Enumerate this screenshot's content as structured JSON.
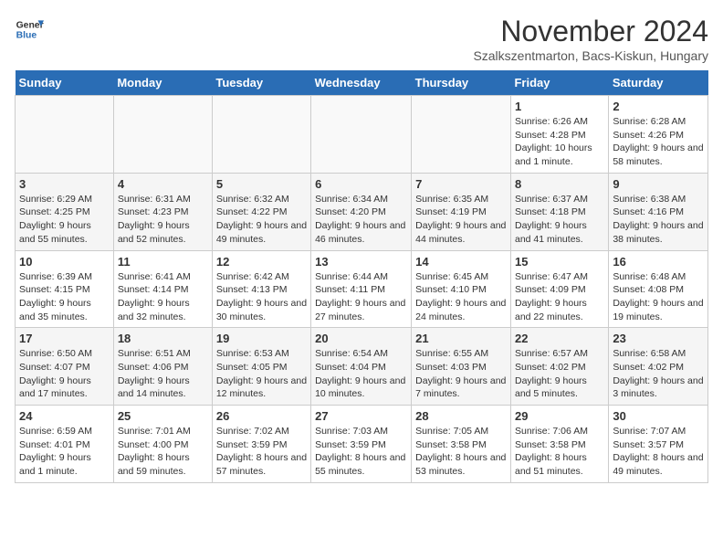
{
  "logo": {
    "line1": "General",
    "line2": "Blue"
  },
  "title": "November 2024",
  "subtitle": "Szalkszentmarton, Bacs-Kiskun, Hungary",
  "weekdays": [
    "Sunday",
    "Monday",
    "Tuesday",
    "Wednesday",
    "Thursday",
    "Friday",
    "Saturday"
  ],
  "weeks": [
    [
      {
        "day": "",
        "info": ""
      },
      {
        "day": "",
        "info": ""
      },
      {
        "day": "",
        "info": ""
      },
      {
        "day": "",
        "info": ""
      },
      {
        "day": "",
        "info": ""
      },
      {
        "day": "1",
        "info": "Sunrise: 6:26 AM\nSunset: 4:28 PM\nDaylight: 10 hours and 1 minute."
      },
      {
        "day": "2",
        "info": "Sunrise: 6:28 AM\nSunset: 4:26 PM\nDaylight: 9 hours and 58 minutes."
      }
    ],
    [
      {
        "day": "3",
        "info": "Sunrise: 6:29 AM\nSunset: 4:25 PM\nDaylight: 9 hours and 55 minutes."
      },
      {
        "day": "4",
        "info": "Sunrise: 6:31 AM\nSunset: 4:23 PM\nDaylight: 9 hours and 52 minutes."
      },
      {
        "day": "5",
        "info": "Sunrise: 6:32 AM\nSunset: 4:22 PM\nDaylight: 9 hours and 49 minutes."
      },
      {
        "day": "6",
        "info": "Sunrise: 6:34 AM\nSunset: 4:20 PM\nDaylight: 9 hours and 46 minutes."
      },
      {
        "day": "7",
        "info": "Sunrise: 6:35 AM\nSunset: 4:19 PM\nDaylight: 9 hours and 44 minutes."
      },
      {
        "day": "8",
        "info": "Sunrise: 6:37 AM\nSunset: 4:18 PM\nDaylight: 9 hours and 41 minutes."
      },
      {
        "day": "9",
        "info": "Sunrise: 6:38 AM\nSunset: 4:16 PM\nDaylight: 9 hours and 38 minutes."
      }
    ],
    [
      {
        "day": "10",
        "info": "Sunrise: 6:39 AM\nSunset: 4:15 PM\nDaylight: 9 hours and 35 minutes."
      },
      {
        "day": "11",
        "info": "Sunrise: 6:41 AM\nSunset: 4:14 PM\nDaylight: 9 hours and 32 minutes."
      },
      {
        "day": "12",
        "info": "Sunrise: 6:42 AM\nSunset: 4:13 PM\nDaylight: 9 hours and 30 minutes."
      },
      {
        "day": "13",
        "info": "Sunrise: 6:44 AM\nSunset: 4:11 PM\nDaylight: 9 hours and 27 minutes."
      },
      {
        "day": "14",
        "info": "Sunrise: 6:45 AM\nSunset: 4:10 PM\nDaylight: 9 hours and 24 minutes."
      },
      {
        "day": "15",
        "info": "Sunrise: 6:47 AM\nSunset: 4:09 PM\nDaylight: 9 hours and 22 minutes."
      },
      {
        "day": "16",
        "info": "Sunrise: 6:48 AM\nSunset: 4:08 PM\nDaylight: 9 hours and 19 minutes."
      }
    ],
    [
      {
        "day": "17",
        "info": "Sunrise: 6:50 AM\nSunset: 4:07 PM\nDaylight: 9 hours and 17 minutes."
      },
      {
        "day": "18",
        "info": "Sunrise: 6:51 AM\nSunset: 4:06 PM\nDaylight: 9 hours and 14 minutes."
      },
      {
        "day": "19",
        "info": "Sunrise: 6:53 AM\nSunset: 4:05 PM\nDaylight: 9 hours and 12 minutes."
      },
      {
        "day": "20",
        "info": "Sunrise: 6:54 AM\nSunset: 4:04 PM\nDaylight: 9 hours and 10 minutes."
      },
      {
        "day": "21",
        "info": "Sunrise: 6:55 AM\nSunset: 4:03 PM\nDaylight: 9 hours and 7 minutes."
      },
      {
        "day": "22",
        "info": "Sunrise: 6:57 AM\nSunset: 4:02 PM\nDaylight: 9 hours and 5 minutes."
      },
      {
        "day": "23",
        "info": "Sunrise: 6:58 AM\nSunset: 4:02 PM\nDaylight: 9 hours and 3 minutes."
      }
    ],
    [
      {
        "day": "24",
        "info": "Sunrise: 6:59 AM\nSunset: 4:01 PM\nDaylight: 9 hours and 1 minute."
      },
      {
        "day": "25",
        "info": "Sunrise: 7:01 AM\nSunset: 4:00 PM\nDaylight: 8 hours and 59 minutes."
      },
      {
        "day": "26",
        "info": "Sunrise: 7:02 AM\nSunset: 3:59 PM\nDaylight: 8 hours and 57 minutes."
      },
      {
        "day": "27",
        "info": "Sunrise: 7:03 AM\nSunset: 3:59 PM\nDaylight: 8 hours and 55 minutes."
      },
      {
        "day": "28",
        "info": "Sunrise: 7:05 AM\nSunset: 3:58 PM\nDaylight: 8 hours and 53 minutes."
      },
      {
        "day": "29",
        "info": "Sunrise: 7:06 AM\nSunset: 3:58 PM\nDaylight: 8 hours and 51 minutes."
      },
      {
        "day": "30",
        "info": "Sunrise: 7:07 AM\nSunset: 3:57 PM\nDaylight: 8 hours and 49 minutes."
      }
    ]
  ]
}
